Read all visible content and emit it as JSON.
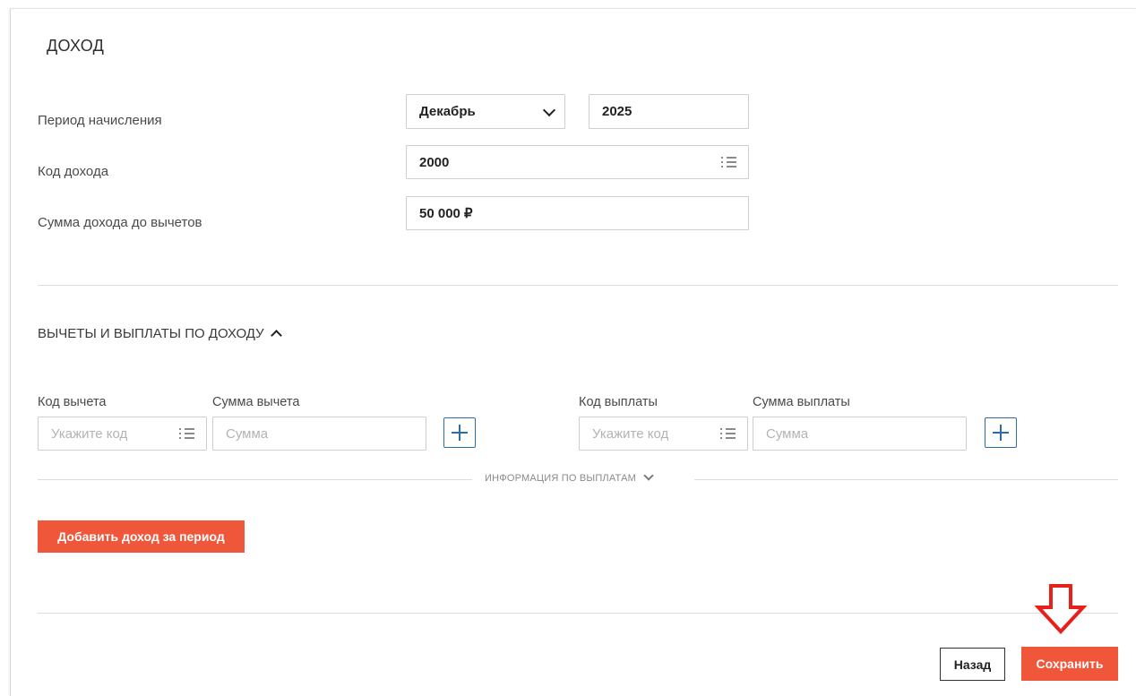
{
  "form": {
    "title": "ДОХОД",
    "accrual_period": {
      "label": "Период начисления",
      "month_value": "Декабрь",
      "year_value": "2025"
    },
    "income_code": {
      "label": "Код дохода",
      "value": "2000"
    },
    "income_amount": {
      "label": "Сумма дохода до вычетов",
      "value": "50 000 ₽"
    }
  },
  "deductions": {
    "section_title": "ВЫЧЕТЫ И ВЫПЛАТЫ ПО ДОХОДУ",
    "deduction_code_label": "Код вычета",
    "deduction_code_placeholder": "Укажите код",
    "deduction_amount_label": "Сумма вычета",
    "deduction_amount_placeholder": "Сумма",
    "payment_code_label": "Код выплаты",
    "payment_code_placeholder": "Укажите код",
    "payment_amount_label": "Сумма выплаты",
    "payment_amount_placeholder": "Сумма",
    "payments_info_label": "ИНФОРМАЦИЯ ПО ВЫПЛАТАМ"
  },
  "actions": {
    "add_income_label": "Добавить доход за период",
    "back_label": "Назад",
    "save_label": "Сохранить"
  },
  "colors": {
    "accent": "#f0563a",
    "plus_button": "#2e6da4",
    "annotation_arrow": "#e8201a"
  },
  "icons": {
    "dropdown": "chevron-down-icon",
    "list": "list-icon",
    "add": "plus-icon",
    "collapse": "chevron-up-icon",
    "expand": "chevron-down-icon",
    "annotation": "arrow-down-icon"
  }
}
